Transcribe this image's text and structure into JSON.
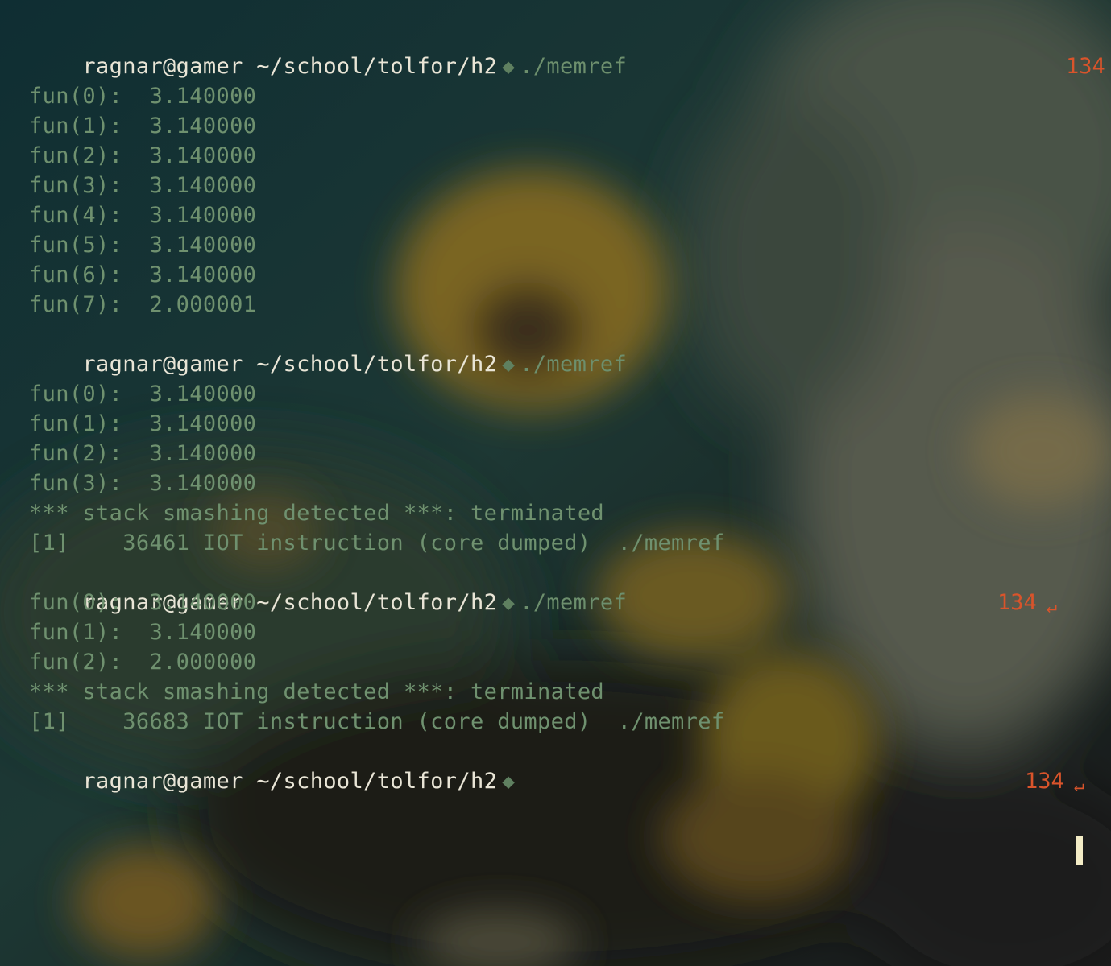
{
  "wallpaper": {
    "description_colors": [
      "#123438",
      "#3f4a3a",
      "#8a6b22",
      "#2e3b2c",
      "#6b6a5a"
    ]
  },
  "prompt": {
    "user_host": "ragnar@gamer",
    "path": "~/school/tolfor/h2",
    "symbol": "◆"
  },
  "blocks": [
    {
      "command": "./memref",
      "status": {
        "code": "134",
        "icon": "↵"
      },
      "output": [
        "",
        "fun(0):  3.140000",
        "fun(1):  3.140000",
        "fun(2):  3.140000",
        "fun(3):  3.140000",
        "fun(4):  3.140000",
        "fun(5):  3.140000",
        "fun(6):  3.140000",
        "fun(7):  2.000001"
      ]
    },
    {
      "command": "./memref",
      "output": [
        "",
        "fun(0):  3.140000",
        "fun(1):  3.140000",
        "fun(2):  3.140000",
        "fun(3):  3.140000",
        "*** stack smashing detected ***: terminated",
        "[1]    36461 IOT instruction (core dumped)  ./memref"
      ]
    },
    {
      "command": "./memref",
      "status": {
        "code": "134",
        "icon": "↵"
      },
      "output": [
        "fun(0):  3.140000",
        "fun(1):  3.140000",
        "fun(2):  2.000000",
        "*** stack smashing detected ***: terminated",
        "[1]    36683 IOT instruction (core dumped)  ./memref"
      ]
    },
    {
      "command": "",
      "status": {
        "code": "134",
        "icon": "↵"
      },
      "output": []
    }
  ]
}
